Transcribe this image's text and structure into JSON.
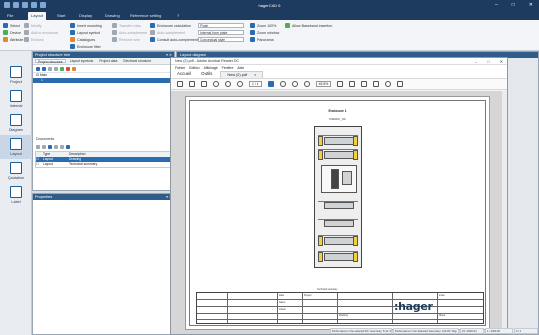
{
  "app": {
    "title": "hagerCAD 6",
    "window_controls": [
      "–",
      "□",
      "✕"
    ],
    "quick_access_icons": [
      "app-icon",
      "save-icon",
      "print-icon",
      "undo-icon",
      "redo-icon"
    ]
  },
  "ribbon": {
    "tabs": [
      "File",
      "Layout",
      "Start",
      "Display",
      "Drawing",
      "Reference setting",
      "?"
    ],
    "active_tab": "Layout",
    "groups": {
      "select": [
        "Select",
        "Device",
        "Attribute"
      ],
      "edit": [
        "Modify",
        "Add to enclosure",
        "Insert",
        "Enclose"
      ],
      "insert": [
        "Insert mounting",
        "Layout symbol",
        "Catalogues",
        "Enclosure filter"
      ],
      "options": [
        "Transfer rows",
        "Auto-complement",
        "Remove wire",
        "Create"
      ],
      "enclosure": [
        "Enclosure calculation",
        "Auto-complement",
        "Consult auto-complement"
      ],
      "dropdowns": [
        "Flush",
        "Internal form plate",
        "Conceptual style"
      ],
      "zoom": [
        "Zoom 100%",
        "Zoom window",
        "Panorama"
      ],
      "extra": "Allow Baseband insertion"
    }
  },
  "leftnav": {
    "items": [
      "Project",
      "Internal",
      "Diagram",
      "Layout",
      "Quotation",
      "Label"
    ],
    "active": "Layout"
  },
  "project_panel": {
    "title": "Project structure tree",
    "tabs": [
      "Project structure",
      "Layout symbols",
      "Project data",
      "Electrical structure"
    ],
    "tree": [
      "Main",
      "1"
    ],
    "documents_label": "Documents",
    "columns": [
      "",
      "Type",
      "Description"
    ],
    "rows": [
      {
        "type": "Layout",
        "desc": "Drawing"
      },
      {
        "type": "Layout",
        "desc": "Technical summary"
      }
    ]
  },
  "properties_panel": {
    "title": "Properties"
  },
  "layout_diagram": {
    "title": "Layout diagram"
  },
  "pdf_viewer": {
    "title": "New (2).pdf - Adobe Acrobat Reader DC",
    "menu": [
      "Fichier",
      "Edition",
      "Affichage",
      "Fenêtre",
      "Aide"
    ],
    "tabs": {
      "home": "Accueil",
      "tools": "Outils",
      "file": "New (2).pdf",
      "close": "×"
    },
    "page_current": "1",
    "page_total": "/ 1",
    "zoom": "45,8%"
  },
  "drawing": {
    "heading": "Enclosure 1",
    "subheading": "FW4C3 _04",
    "brand": ":hager",
    "title_block_label": "Technical summary",
    "cells": [
      "Project",
      "Date",
      "Name",
      "Check",
      "Drawing",
      "Index",
      "Sheet"
    ]
  },
  "statusbar": {
    "items": [
      "Performance in the selected DC: Geometry: 6.12 / Ray",
      "Performance in the Selected: Geometry: 123.45 / Ray",
      "15 / 2020-04",
      "1 / 1000.00",
      "0 / 1"
    ]
  },
  "colors": {
    "titlebar": "#1d3b5e",
    "panel_header": "#2f5d8a",
    "selection": "#2b6cb0",
    "hager_blue": "#1d3b5e",
    "module_yellow": "#f2d23c"
  }
}
